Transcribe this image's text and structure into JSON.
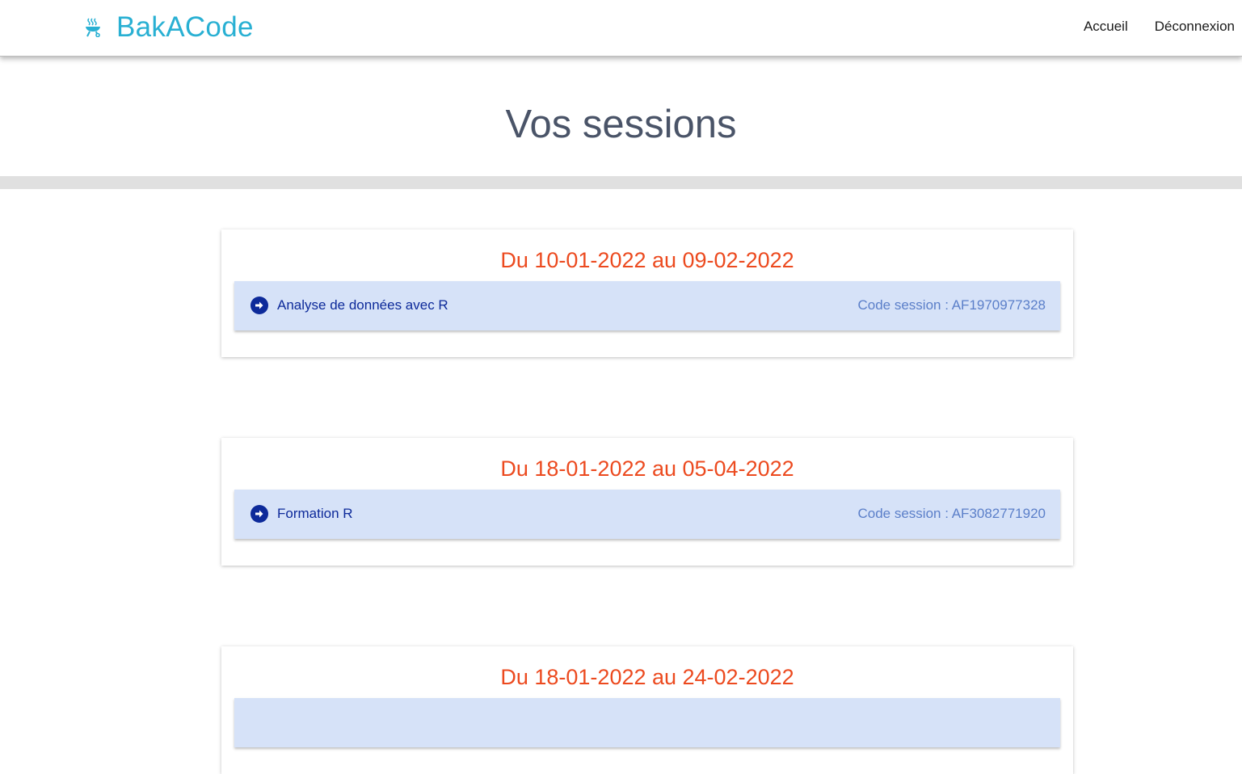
{
  "navbar": {
    "brand": "BakACode",
    "brand_icon": "bbq-grill-icon",
    "links": [
      "Accueil",
      "Déconnexion"
    ]
  },
  "page": {
    "title": "Vos sessions"
  },
  "sessions": [
    {
      "date_range": "Du 10-01-2022 au 09-02-2022",
      "name": "Analyse de données avec R",
      "code_text": "Code session : AF1970977328"
    },
    {
      "date_range": "Du 18-01-2022 au 05-04-2022",
      "name": "Formation R",
      "code_text": "Code session : AF3082771920"
    },
    {
      "date_range": "Du 18-01-2022 au 24-02-2022"
    }
  ],
  "colors": {
    "brand": "#29b0d3",
    "title": "#4a5468",
    "date": "#ec4a1f",
    "row_bg": "#d6e2f8",
    "session_name": "#0d2a9a",
    "session_code": "#5b7fc9"
  }
}
